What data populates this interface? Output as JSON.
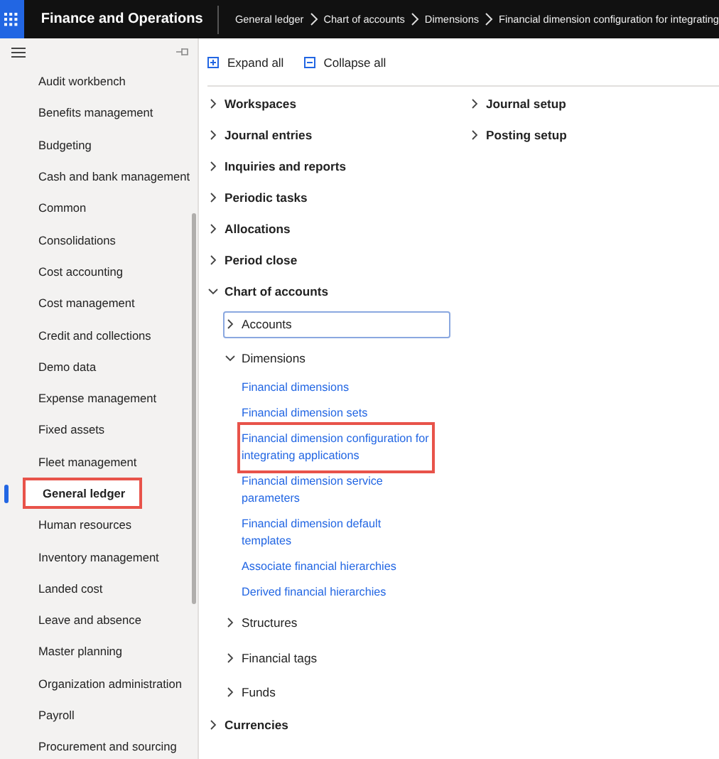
{
  "header": {
    "app_title": "Finance and Operations",
    "breadcrumbs": [
      "General ledger",
      "Chart of accounts",
      "Dimensions",
      "Financial dimension configuration for integrating"
    ]
  },
  "sidebar": {
    "items": [
      {
        "label": "Audit workbench",
        "selected": false,
        "highlighted": false
      },
      {
        "label": "Benefits management",
        "selected": false,
        "highlighted": false
      },
      {
        "label": "Budgeting",
        "selected": false,
        "highlighted": false
      },
      {
        "label": "Cash and bank management",
        "selected": false,
        "highlighted": false
      },
      {
        "label": "Common",
        "selected": false,
        "highlighted": false
      },
      {
        "label": "Consolidations",
        "selected": false,
        "highlighted": false
      },
      {
        "label": "Cost accounting",
        "selected": false,
        "highlighted": false
      },
      {
        "label": "Cost management",
        "selected": false,
        "highlighted": false
      },
      {
        "label": "Credit and collections",
        "selected": false,
        "highlighted": false
      },
      {
        "label": "Demo data",
        "selected": false,
        "highlighted": false
      },
      {
        "label": "Expense management",
        "selected": false,
        "highlighted": false
      },
      {
        "label": "Fixed assets",
        "selected": false,
        "highlighted": false
      },
      {
        "label": "Fleet management",
        "selected": false,
        "highlighted": false
      },
      {
        "label": "General ledger",
        "selected": true,
        "highlighted": true
      },
      {
        "label": "Human resources",
        "selected": false,
        "highlighted": false
      },
      {
        "label": "Inventory management",
        "selected": false,
        "highlighted": false
      },
      {
        "label": "Landed cost",
        "selected": false,
        "highlighted": false
      },
      {
        "label": "Leave and absence",
        "selected": false,
        "highlighted": false
      },
      {
        "label": "Master planning",
        "selected": false,
        "highlighted": false
      },
      {
        "label": "Organization administration",
        "selected": false,
        "highlighted": false
      },
      {
        "label": "Payroll",
        "selected": false,
        "highlighted": false
      },
      {
        "label": "Procurement and sourcing",
        "selected": false,
        "highlighted": false
      }
    ]
  },
  "toolbar": [
    {
      "label": "Expand all",
      "kind": "expand"
    },
    {
      "label": "Collapse all",
      "kind": "collapse"
    }
  ],
  "columns": [
    [
      {
        "kind": "group",
        "label": "Workspaces",
        "expanded": false
      },
      {
        "kind": "group",
        "label": "Journal entries",
        "expanded": false
      },
      {
        "kind": "group",
        "label": "Inquiries and reports",
        "expanded": false
      },
      {
        "kind": "group",
        "label": "Periodic tasks",
        "expanded": false
      },
      {
        "kind": "group",
        "label": "Allocations",
        "expanded": false
      },
      {
        "kind": "group",
        "label": "Period close",
        "expanded": false
      },
      {
        "kind": "group",
        "label": "Chart of accounts",
        "expanded": true,
        "children": [
          {
            "kind": "group",
            "label": "Accounts",
            "expanded": false,
            "focused": true
          },
          {
            "kind": "group",
            "label": "Dimensions",
            "expanded": true,
            "children": [
              {
                "kind": "link",
                "label": "Financial dimensions",
                "highlighted": false
              },
              {
                "kind": "link",
                "label": "Financial dimension sets",
                "highlighted": false
              },
              {
                "kind": "link",
                "label": "Financial dimension configuration for integrating applications",
                "highlighted": true
              },
              {
                "kind": "link",
                "label": "Financial dimension service parameters",
                "highlighted": false
              },
              {
                "kind": "link",
                "label": "Financial dimension default templates",
                "highlighted": false
              },
              {
                "kind": "link",
                "label": "Associate financial hierarchies",
                "highlighted": false
              },
              {
                "kind": "link",
                "label": "Derived financial hierarchies",
                "highlighted": false
              }
            ]
          },
          {
            "kind": "group",
            "label": "Structures",
            "expanded": false
          },
          {
            "kind": "group",
            "label": "Financial tags",
            "expanded": false
          },
          {
            "kind": "group",
            "label": "Funds",
            "expanded": false
          }
        ]
      },
      {
        "kind": "group",
        "label": "Currencies",
        "expanded": false
      }
    ],
    [
      {
        "kind": "group",
        "label": "Journal setup",
        "expanded": false
      },
      {
        "kind": "group",
        "label": "Posting setup",
        "expanded": false
      }
    ]
  ]
}
